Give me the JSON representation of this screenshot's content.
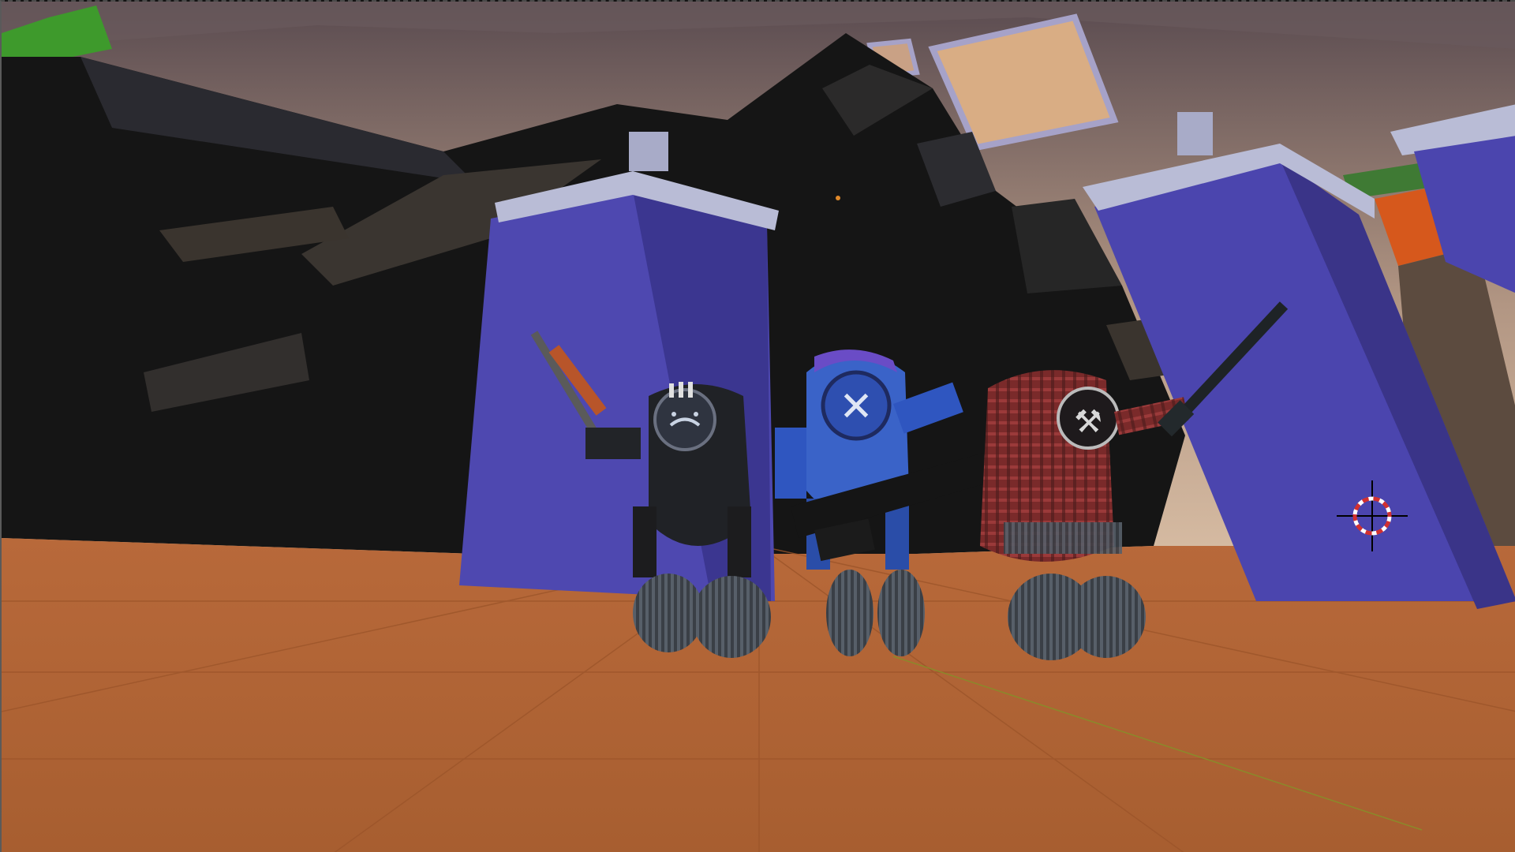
{
  "viewport": {
    "kind": "3d-viewport",
    "render_mode": "solid shaded"
  },
  "scene": {
    "objects": [
      {
        "name": "ground-plane",
        "color": "#ae6334"
      },
      {
        "name": "dark-rock-formation",
        "color": "#141414"
      },
      {
        "name": "purple-pillar-left",
        "color": "#4e48b0"
      },
      {
        "name": "purple-pillar-right",
        "color": "#4b45ae"
      },
      {
        "name": "orange-block",
        "color": "#d6581c"
      },
      {
        "name": "green-tree",
        "color": "#3e9a2c"
      }
    ],
    "characters": [
      {
        "name": "black-robot",
        "emblem": "sad-face-icon",
        "weapon": "assault-rifle",
        "color": "#222428"
      },
      {
        "name": "blue-robot",
        "emblem": "x-icon",
        "weapon": "minigun",
        "color": "#3a63c8"
      },
      {
        "name": "plaid-robot",
        "emblem": "crossed-axes-icon",
        "weapon": "rifle",
        "color": "#8a2e2e"
      }
    ]
  },
  "cursor": {
    "icon": "3d-cursor-icon",
    "ring_color": "#d23030"
  },
  "colors": {
    "sky_top": "#5e4f52",
    "sky_bottom": "#cbb09a",
    "floor": "#ae6334",
    "pillar": "#4b45ae",
    "pillar_cap": "#b9bcd6"
  }
}
